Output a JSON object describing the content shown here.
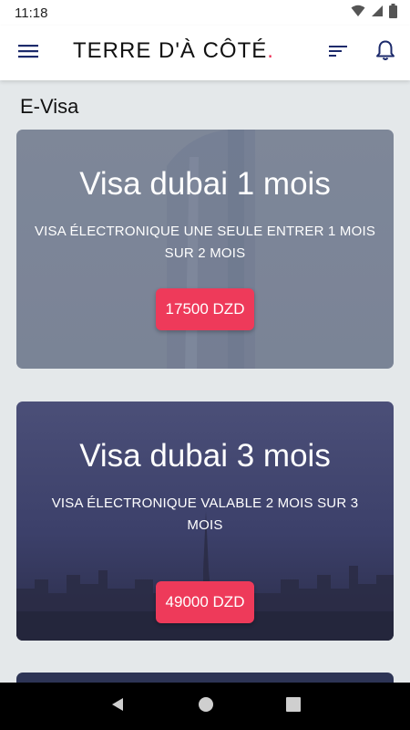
{
  "status_bar": {
    "time": "11:18",
    "icons": [
      "wifi-icon",
      "signal-icon",
      "battery-icon"
    ]
  },
  "app_bar": {
    "brand": "TERRE D'À CÔTÉ",
    "brand_dot": ".",
    "brand_dot_color": "#ee2f55",
    "icons": [
      "menu-icon",
      "sort-icon",
      "bell-icon"
    ]
  },
  "section": {
    "title": "E-Visa"
  },
  "cards": [
    {
      "title": "Visa dubai 1 mois",
      "description": "VISA ÉLECTRONIQUE UNE SEULE ENTRER 1 MOIS SUR 2 MOIS",
      "price": "17500 DZD"
    },
    {
      "title": "Visa dubai 3 mois",
      "description": "VISA ÉLECTRONIQUE VALABLE 2 MOIS SUR 3 MOIS",
      "price": "49000 DZD"
    }
  ],
  "accent_color": "#ee3a5a",
  "nav_bar": {
    "icons": [
      "back-icon",
      "home-icon",
      "recents-icon"
    ]
  }
}
